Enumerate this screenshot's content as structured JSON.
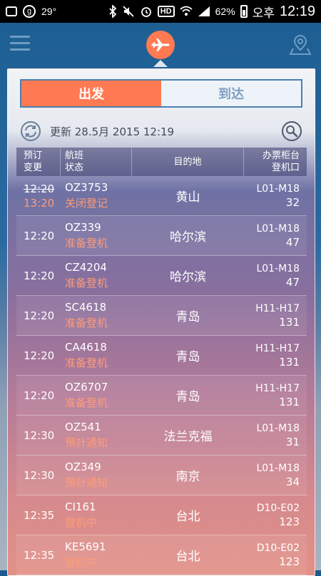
{
  "status_bar": {
    "temperature": "29°",
    "battery": "62%",
    "ampm": "오후",
    "time": "12:19",
    "hd_label": "HD",
    "g_label": "g"
  },
  "colors": {
    "accent": "#ff7a52",
    "status_text": "#ff9b78",
    "header_bg": "#1e5f93"
  },
  "tabs": [
    {
      "label": "出发",
      "active": true
    },
    {
      "label": "到达",
      "active": false
    }
  ],
  "update": {
    "text": "更新 28.5月 2015 12:19"
  },
  "table": {
    "headers": {
      "col1_line1": "预订",
      "col1_line2": "变更",
      "col2_line1": "航班",
      "col2_line2": "状态",
      "col3": "目的地",
      "col4_line1": "办票柜台",
      "col4_line2": "登机口"
    },
    "rows": [
      {
        "time_old": "12:20",
        "time": "13:20",
        "flight": "OZ3753",
        "status": "关闭登记",
        "dest": "黄山",
        "counter": "L01-M18",
        "gate": "32"
      },
      {
        "time_old": "",
        "time": "12:20",
        "flight": "OZ339",
        "status": "准备登机",
        "dest": "哈尔滨",
        "counter": "L01-M18",
        "gate": "47"
      },
      {
        "time_old": "",
        "time": "12:20",
        "flight": "CZ4204",
        "status": "准备登机",
        "dest": "哈尔滨",
        "counter": "L01-M18",
        "gate": "47"
      },
      {
        "time_old": "",
        "time": "12:20",
        "flight": "SC4618",
        "status": "准备登机",
        "dest": "青岛",
        "counter": "H11-H17",
        "gate": "131"
      },
      {
        "time_old": "",
        "time": "12:20",
        "flight": "CA4618",
        "status": "准备登机",
        "dest": "青岛",
        "counter": "H11-H17",
        "gate": "131"
      },
      {
        "time_old": "",
        "time": "12:20",
        "flight": "OZ6707",
        "status": "准备登机",
        "dest": "青岛",
        "counter": "H11-H17",
        "gate": "131"
      },
      {
        "time_old": "",
        "time": "12:30",
        "flight": "OZ541",
        "status": "預計通知",
        "dest": "法兰克福",
        "counter": "L01-M18",
        "gate": "31"
      },
      {
        "time_old": "",
        "time": "12:30",
        "flight": "OZ349",
        "status": "預計通知",
        "dest": "南京",
        "counter": "L01-M18",
        "gate": "34"
      },
      {
        "time_old": "",
        "time": "12:35",
        "flight": "CI161",
        "status": "登机中",
        "dest": "台北",
        "counter": "D10-E02",
        "gate": "123"
      },
      {
        "time_old": "",
        "time": "12:35",
        "flight": "KE5691",
        "status": "登机中",
        "dest": "台北",
        "counter": "D10-E02",
        "gate": "123"
      }
    ]
  }
}
